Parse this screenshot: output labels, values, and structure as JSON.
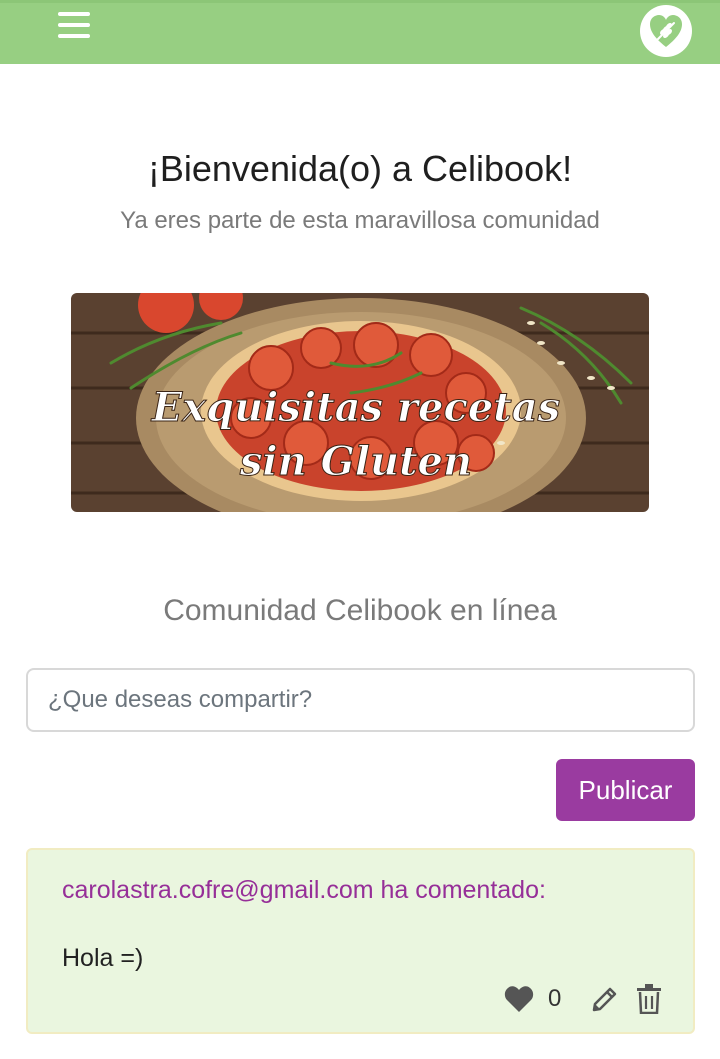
{
  "header": {
    "menu_icon": "hamburger-menu-icon",
    "logo_icon": "heart-wheat-logo-icon",
    "bar_color": "#97cf82"
  },
  "welcome": {
    "title": "¡Bienvenida(o) a Celibook!",
    "subtitle": "Ya eres parte de esta maravillosa comunidad"
  },
  "banner": {
    "line1": "Exquisitas recetas",
    "line2": "sin Gluten"
  },
  "community": {
    "title": "Comunidad Celibook en línea"
  },
  "composer": {
    "placeholder": "¿Que deseas compartir?",
    "value": "",
    "publish_label": "Publicar",
    "accent_color": "#9a3ba0"
  },
  "posts": [
    {
      "author_line": "carolastra.cofre@gmail.com ha comentado:",
      "body": "Hola =)",
      "likes": "0",
      "icons": [
        "heart-icon",
        "pencil-icon",
        "trash-icon"
      ]
    }
  ]
}
